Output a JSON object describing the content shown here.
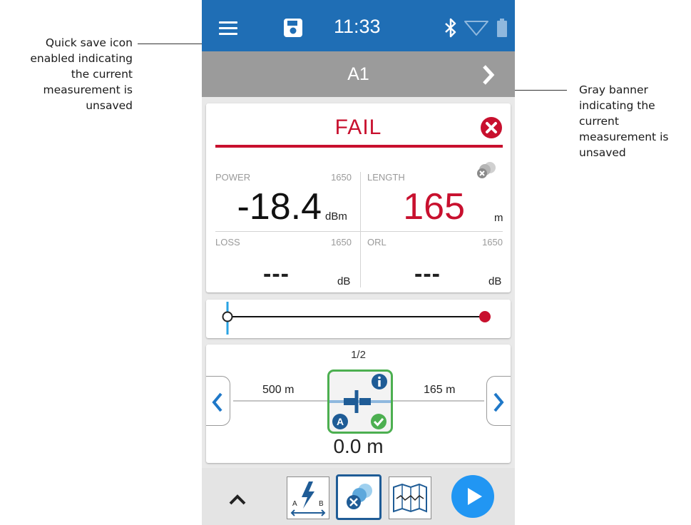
{
  "callouts": {
    "left_lines": [
      "Quick save icon",
      "enabled indicating",
      "the current",
      "measurement is",
      "unsaved"
    ],
    "right_lines": [
      "Gray banner",
      "indicating the",
      "current",
      "measurement is",
      "unsaved"
    ]
  },
  "status_bar": {
    "time": "11:33",
    "icons": [
      "menu-icon",
      "save-icon",
      "bluetooth-icon",
      "wifi-icon",
      "battery-icon"
    ],
    "color": "#1f6eb5"
  },
  "banner": {
    "title": "A1",
    "color": "#9b9b9b"
  },
  "result": {
    "status": "FAIL",
    "status_color": "#c8102e",
    "power": {
      "label": "POWER",
      "wavelength": "1650",
      "value": "-18.4",
      "unit": "dBm"
    },
    "length": {
      "label": "LENGTH",
      "value": "165",
      "unit": "m",
      "value_color": "#c8102e"
    },
    "loss": {
      "label": "LOSS",
      "wavelength": "1650",
      "value": "---",
      "unit": "dB"
    },
    "orl": {
      "label": "ORL",
      "wavelength": "1650",
      "value": "---",
      "unit": "dB"
    }
  },
  "link_view": {
    "page": "1/2",
    "distance_before": "500 m",
    "distance_after": "165 m",
    "event_position": "0.0 m",
    "accent_color": "#4caf50"
  },
  "toolbar": {
    "items": [
      "collapse-up-button",
      "link-test-button",
      "fault-locator-button",
      "map-view-button",
      "start-button"
    ],
    "link_test_ends": [
      "A",
      "B"
    ],
    "active_item": "fault-locator-button",
    "start_color": "#2196f3"
  }
}
